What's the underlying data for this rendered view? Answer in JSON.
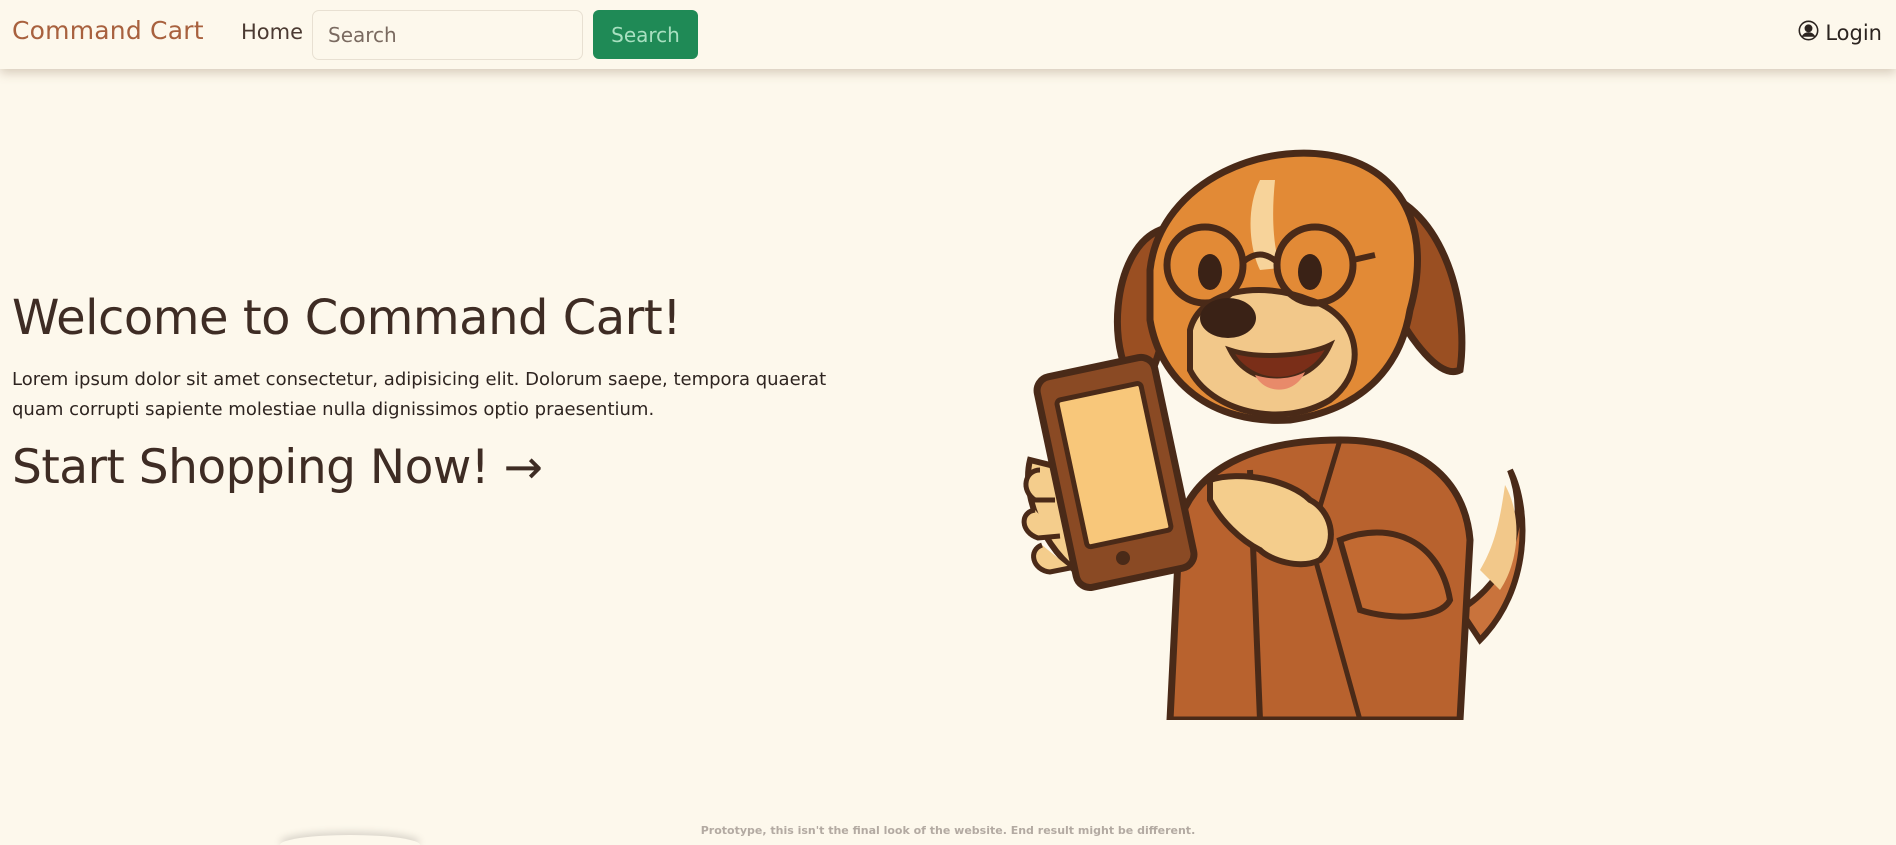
{
  "header": {
    "brand": "Command Cart",
    "nav_home": "Home",
    "search": {
      "placeholder": "Search",
      "value": "",
      "button_label": "Search"
    },
    "login_label": "Login"
  },
  "hero": {
    "title": "Welcome to Command Cart!",
    "description": "Lorem ipsum dolor sit amet consectetur, adipisicing elit. Dolorum saepe, tempora quaerat quam corrupti sapiente molestiae nulla dignissimos optio praesentium.",
    "cta_label": "Start Shopping Now!",
    "cta_arrow": "→"
  },
  "footer": {
    "note": "Prototype, this isn't the final look of the website. End result might be different."
  },
  "colors": {
    "background": "#fdf8ec",
    "brand": "#a8613e",
    "search_button": "#1f8a56",
    "text": "#3e2c24"
  },
  "icons": {
    "login": "user-circle-icon",
    "mascot": "dog-with-phone-illustration"
  }
}
